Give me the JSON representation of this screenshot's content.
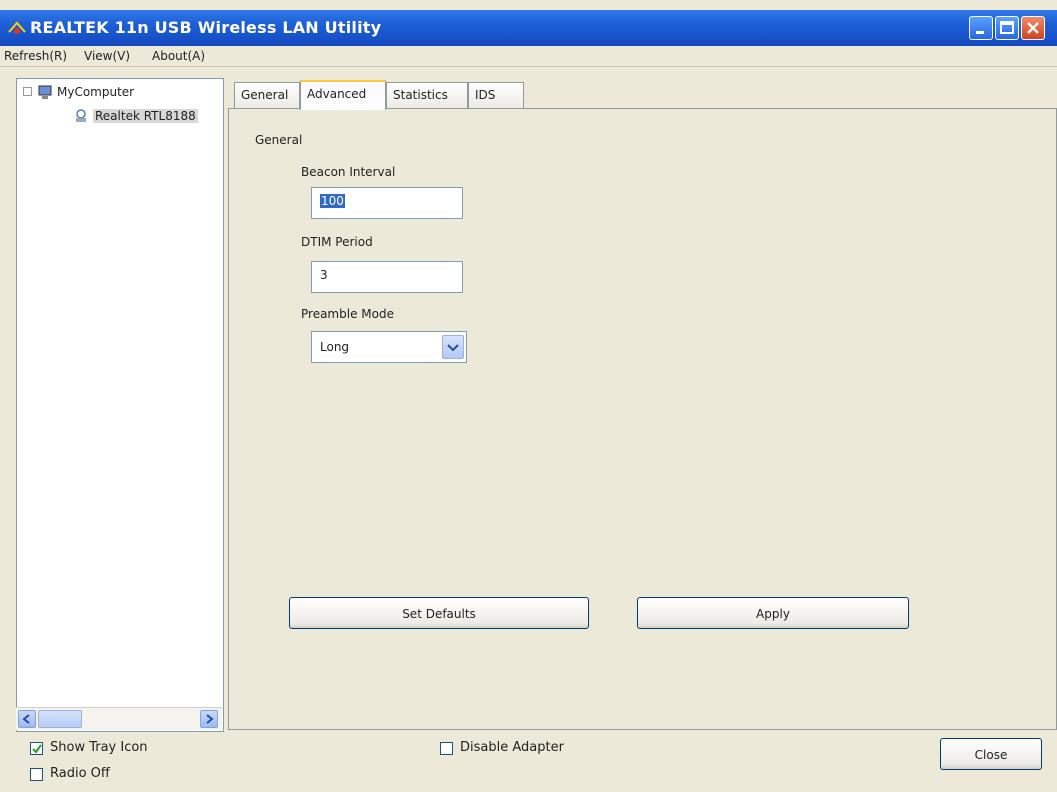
{
  "window": {
    "title": "REALTEK 11n USB Wireless LAN Utility",
    "title_bar_color": "#1d5fd6"
  },
  "menu": {
    "items": [
      "Refresh(R)",
      "View(V)",
      "About(A)"
    ]
  },
  "tree": {
    "root_label": "MyComputer",
    "child_label": "Realtek RTL8188"
  },
  "tabs": [
    {
      "label": "General"
    },
    {
      "label": "Advanced",
      "active": true
    },
    {
      "label": "Statistics"
    },
    {
      "label": "IDS"
    }
  ],
  "advanced": {
    "group_label": "General",
    "beacon_label": "Beacon Interval",
    "beacon_value": "100",
    "dtim_label": "DTIM Period",
    "dtim_value": "3",
    "preamble_label": "Preamble Mode",
    "preamble_value": "Long",
    "set_defaults_label": "Set Defaults",
    "apply_label": "Apply"
  },
  "bottom": {
    "show_tray_label": "Show Tray Icon",
    "show_tray_checked": true,
    "radio_off_label": "Radio Off",
    "radio_off_checked": false,
    "disable_adapter_label": "Disable Adapter",
    "disable_adapter_checked": false,
    "close_label": "Close"
  }
}
